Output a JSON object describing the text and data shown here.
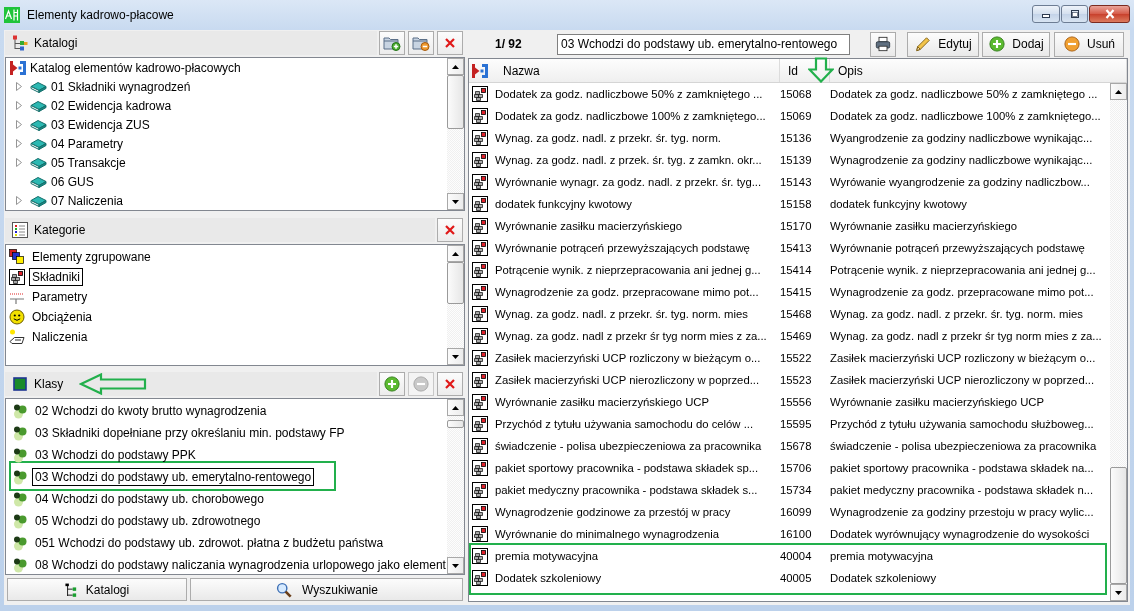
{
  "window": {
    "title": "Elementy kadrowo-płacowe"
  },
  "catalogs": {
    "title": "Katalogi",
    "buttons": [
      {
        "kind": "add-folder"
      },
      {
        "kind": "remove-folder"
      },
      {
        "kind": "close"
      }
    ],
    "tree": [
      {
        "label": "Katalog elementów kadrowo-płacowych",
        "kind": "root",
        "expandable": false,
        "children": [
          {
            "label": "01 Składniki wynagrodzeń",
            "kind": "book",
            "expandable": true
          },
          {
            "label": "02 Ewidencja kadrowa",
            "kind": "book",
            "expandable": true
          },
          {
            "label": "03 Ewidencja ZUS",
            "kind": "book",
            "expandable": true
          },
          {
            "label": "04 Parametry",
            "kind": "book",
            "expandable": true
          },
          {
            "label": "05 Transakcje",
            "kind": "book",
            "expandable": true
          },
          {
            "label": "06 GUS",
            "kind": "book",
            "expandable": false
          },
          {
            "label": "07 Naliczenia",
            "kind": "book",
            "expandable": true
          }
        ]
      }
    ]
  },
  "categories": {
    "title": "Kategorie",
    "buttons": [
      {
        "kind": "close"
      }
    ],
    "items": [
      {
        "label": "Elementy zgrupowane",
        "kind": "grouped",
        "selected": false
      },
      {
        "label": "Składniki",
        "kind": "components",
        "selected": true
      },
      {
        "label": "Parametry",
        "kind": "parameters",
        "selected": false
      },
      {
        "label": "Obciążenia",
        "kind": "charges",
        "selected": false
      },
      {
        "label": "Naliczenia",
        "kind": "accruals",
        "selected": false
      }
    ]
  },
  "classes": {
    "title": "Klasy",
    "marked": true,
    "buttons": [
      {
        "kind": "add",
        "disabled": false
      },
      {
        "kind": "remove",
        "disabled": true
      },
      {
        "kind": "close",
        "disabled": false
      }
    ],
    "items": [
      {
        "label": "02 Wchodzi do kwoty brutto wynagrodzenia",
        "selected": false,
        "marked": false
      },
      {
        "label": "03 Składniki dopełniane przy określaniu min. podstawy FP",
        "selected": false,
        "marked": false
      },
      {
        "label": "03 Wchodzi do podstawy PPK",
        "selected": false,
        "marked": false
      },
      {
        "label": "03 Wchodzi do podstawy ub. emerytalno-rentowego",
        "selected": true,
        "marked": true
      },
      {
        "label": "04 Wchodzi do podstawy ub. chorobowego",
        "selected": false,
        "marked": false
      },
      {
        "label": "05 Wchodzi do podstawy ub. zdrowotnego",
        "selected": false,
        "marked": false
      },
      {
        "label": "051 Wchodzi do podstawy ub. zdrowot. płatna z budżetu państwa",
        "selected": false,
        "marked": false
      },
      {
        "label": "08 Wchodzi do podstawy naliczania wynagrodzenia urlopowego jako element",
        "selected": false,
        "marked": false
      }
    ]
  },
  "bottom_buttons": [
    {
      "label": "Katalogi",
      "kind": "catalogs"
    },
    {
      "label": "Wyszukiwanie",
      "kind": "search"
    }
  ],
  "toolbar": {
    "counter": "1/ 92",
    "field": {
      "value": "03 Wchodzi do podstawy ub. emerytalno-rentowego"
    },
    "buttons": [
      {
        "kind": "print"
      },
      {
        "label": "Edytuj",
        "kind": "edit"
      },
      {
        "label": "Dodaj",
        "kind": "add"
      },
      {
        "label": "Usuń",
        "kind": "remove"
      }
    ]
  },
  "table": {
    "columns": [
      {
        "label": "Nazwa",
        "marked": false
      },
      {
        "label": "Id",
        "marked": true
      },
      {
        "label": "Opis",
        "marked": false
      }
    ],
    "rows": [
      {
        "name": "Dodatek za godz. nadliczbowe 50% z zamkniętego ...",
        "id": "15068",
        "description": "Dodatek za godz. nadliczbowe 50% z zamkniętego ...",
        "marked": false
      },
      {
        "name": "Dodatek za godz. nadliczbowe 100% z zamkniętego...",
        "id": "15069",
        "description": "Dodatek za godz. nadliczbowe 100% z zamkniętego...",
        "marked": false
      },
      {
        "name": "Wynag. za godz. nadl. z przekr. śr. tyg. norm.",
        "id": "15136",
        "description": "Wyangrodzenie za godziny nadliczbowe wynikając...",
        "marked": false
      },
      {
        "name": "Wynag. za godz. nadl. z przek. śr. tyg. z zamkn. okr...",
        "id": "15139",
        "description": "Wynagrodzenie za godziny nadliczbowe wynikając...",
        "marked": false
      },
      {
        "name": "Wyrównanie wynagr. za godz. nadl. z przekr. śr. tyg...",
        "id": "15143",
        "description": "Wyrówanie wyangrodzenie za godziny nadliczbow...",
        "marked": false
      },
      {
        "name": "dodatek funkcyjny kwotowy",
        "id": "15158",
        "description": "dodatek funkcyjny kwotowy",
        "marked": false
      },
      {
        "name": "Wyrównanie zasiłku macierzyńskiego",
        "id": "15170",
        "description": "Wyrównanie zasiłku macierzyńskiego",
        "marked": false
      },
      {
        "name": "Wyrównanie potrąceń przewyższających podstawę",
        "id": "15413",
        "description": "Wyrównanie potrąceń przewyższających podstawę",
        "marked": false
      },
      {
        "name": "Potrącenie wynik. z nieprzepracowania ani jednej g...",
        "id": "15414",
        "description": "Potrącenie wynik. z nieprzepracowania ani jednej g...",
        "marked": false
      },
      {
        "name": "Wynagrodzenie za godz. przepracowane mimo pot...",
        "id": "15415",
        "description": "Wynagrodzenie za godz. przepracowane mimo pot...",
        "marked": false
      },
      {
        "name": "Wynag. za godz. nadl. z przekr. śr. tyg. norm. mies",
        "id": "15468",
        "description": "Wynag. za godz. nadl. z przekr. śr. tyg. norm. mies",
        "marked": false
      },
      {
        "name": "Wynag. za godz. nadl z przekr śr tyg norm mies z za...",
        "id": "15469",
        "description": "Wynag. za godz. nadl z przekr śr tyg norm mies z za...",
        "marked": false
      },
      {
        "name": "Zasiłek macierzyński UCP rozliczony w bieżącym o...",
        "id": "15522",
        "description": "Zasiłek macierzyński UCP rozliczony w bieżącym o...",
        "marked": false
      },
      {
        "name": "Zasiłek macierzyński UCP nierozliczony w poprzed...",
        "id": "15523",
        "description": "Zasiłek macierzyński UCP nierozliczony w poprzed...",
        "marked": false
      },
      {
        "name": "Wyrównanie zasiłku macierzyńskiego UCP",
        "id": "15556",
        "description": "Wyrównanie zasiłku macierzyńskiego UCP",
        "marked": false
      },
      {
        "name": "Przychód z tytułu używania samochodu do celów ...",
        "id": "15595",
        "description": "Przychód z tytułu używania samochodu służboweg...",
        "marked": false
      },
      {
        "name": "świadczenie - polisa ubezpieczeniowa za pracownika",
        "id": "15678",
        "description": "świadczenie - polisa ubezpieczeniowa za pracownika",
        "marked": false
      },
      {
        "name": "pakiet sportowy pracownika - podstawa składek sp...",
        "id": "15706",
        "description": "pakiet sportowy pracownika - podstawa składek na...",
        "marked": false
      },
      {
        "name": "pakiet medyczny pracownika - podstawa składek s...",
        "id": "15734",
        "description": "pakiet medyczny pracownika - podstawa składek n...",
        "marked": false
      },
      {
        "name": "Wynagrodzenie godzinowe za przestój w pracy",
        "id": "16099",
        "description": "Wynagrodzenie za godziny przestoju w pracy wylic...",
        "marked": false
      },
      {
        "name": "Wyrównanie do minimalnego wynagrodzenia",
        "id": "16100",
        "description": "Dodatek wyrównujący wynagrodzenie do wysokości",
        "marked": false
      },
      {
        "name": "premia motywacyjna",
        "id": "40004",
        "description": "premia motywacyjna",
        "marked": true
      },
      {
        "name": "Dodatek szkoleniowy",
        "id": "40005",
        "description": "Dodatek szkoleniowy",
        "marked": true
      }
    ]
  }
}
